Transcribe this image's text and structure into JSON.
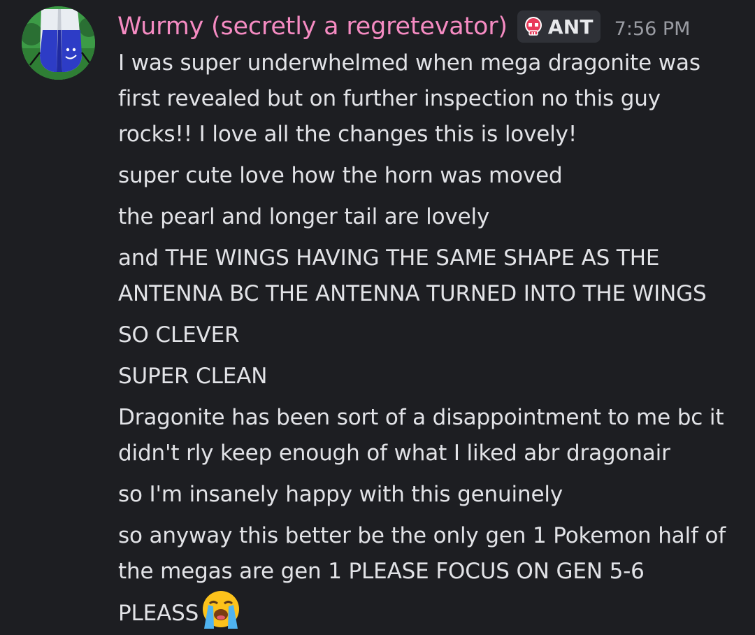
{
  "message": {
    "author": "Wurmy (secretly a regretevator)",
    "tag": {
      "icon": "pink-skull-icon",
      "label": "ANT"
    },
    "timestamp": "7:56 PM",
    "avatar": "avatar-icon",
    "lines": [
      "I was super underwhelmed when mega dragonite was",
      "first revealed but on further inspection no this guy",
      "rocks!! I love all the changes this is lovely!",
      "super cute love how the horn was moved",
      "the pearl and longer tail are lovely",
      "and THE WINGS HAVING THE SAME SHAPE AS THE",
      "ANTENNA BC THE ANTENNA TURNED INTO THE WINGS",
      "SO CLEVER",
      "SUPER CLEAN",
      "Dragonite has been sort of a disappointment to me bc it",
      "didn't rly keep enough of what I liked abr dragonair",
      "so I'm insanely happy with this genuinely",
      "so anyway this better be the only gen 1 Pokemon half of",
      "the megas are gen 1 PLEASE FOCUS ON GEN 5-6",
      "PLEASS"
    ],
    "final_emoji": "loudly-crying-face-emoji"
  },
  "colors": {
    "background": "#1d1e22",
    "username": "#f58bc2",
    "text": "#e2e3e7",
    "timestamp": "#9a9ca3",
    "tag_background": "#2f3137"
  }
}
